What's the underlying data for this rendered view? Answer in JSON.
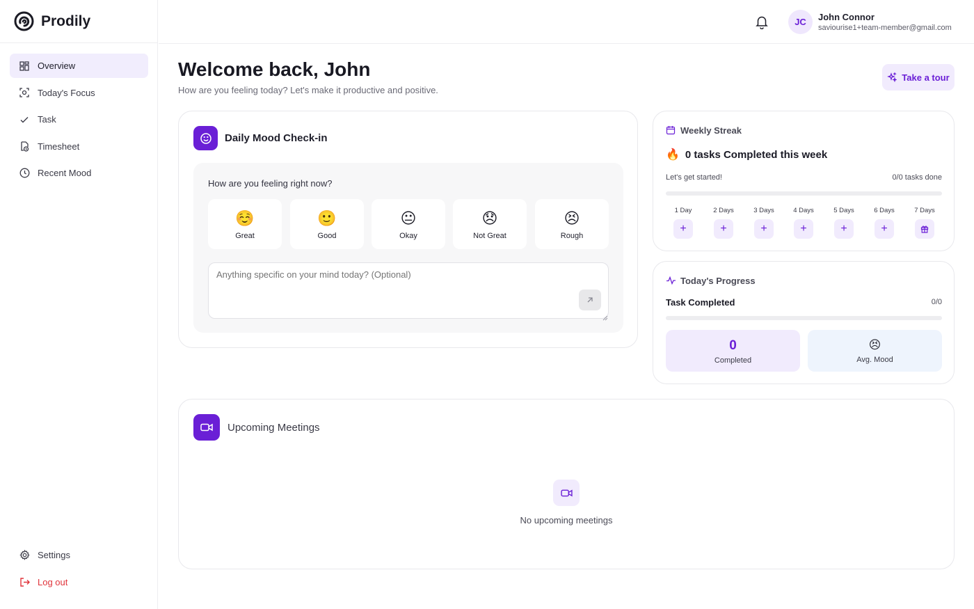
{
  "brand": {
    "name": "Prodily"
  },
  "sidebar": {
    "items": [
      {
        "label": "Overview",
        "icon": "grid-icon",
        "active": true
      },
      {
        "label": "Today's Focus",
        "icon": "focus-icon",
        "active": false
      },
      {
        "label": "Task",
        "icon": "check-icon",
        "active": false
      },
      {
        "label": "Timesheet",
        "icon": "timesheet-icon",
        "active": false
      },
      {
        "label": "Recent Mood",
        "icon": "clock-icon",
        "active": false
      }
    ],
    "bottom": [
      {
        "label": "Settings",
        "icon": "gear-icon"
      },
      {
        "label": "Log out",
        "icon": "logout-icon"
      }
    ]
  },
  "header": {
    "user": {
      "initials": "JC",
      "name": "John Connor",
      "email": "saviourise1+team-member@gmail.com"
    }
  },
  "main": {
    "welcome": "Welcome back, John",
    "subtitle": "How are you feeling today? Let's make it productive and positive.",
    "tour_label": "Take a tour"
  },
  "mood_checkin": {
    "title": "Daily Mood Check-in",
    "question": "How are you feeling right now?",
    "options": [
      {
        "emoji": "☺️",
        "label": "Great"
      },
      {
        "emoji": "🙂",
        "label": "Good"
      },
      {
        "emoji": "😐",
        "label": "Okay"
      },
      {
        "emoji": "😞",
        "label": "Not Great"
      },
      {
        "emoji": "😣",
        "label": "Rough"
      }
    ],
    "input_placeholder": "Anything specific on your mind today? (Optional)"
  },
  "weekly_streak": {
    "title": "Weekly Streak",
    "fire": "🔥",
    "headline": "0 tasks Completed this week",
    "status": "Let's get started!",
    "tasks_done": "0/0 tasks done",
    "progress": 0,
    "days": [
      {
        "label": "1 Day",
        "icon": "+"
      },
      {
        "label": "2 Days",
        "icon": "+"
      },
      {
        "label": "3 Days",
        "icon": "+"
      },
      {
        "label": "4 Days",
        "icon": "+"
      },
      {
        "label": "5 Days",
        "icon": "+"
      },
      {
        "label": "6 Days",
        "icon": "+"
      },
      {
        "label": "7 Days",
        "icon": "gift-icon"
      }
    ]
  },
  "todays_progress": {
    "title": "Today's Progress",
    "task_label": "Task Completed",
    "task_value": "0/0",
    "progress": 0,
    "completed_count": "0",
    "completed_label": "Completed",
    "avg_mood_emoji": "😣",
    "avg_mood_label": "Avg. Mood"
  },
  "meetings": {
    "title": "Upcoming Meetings",
    "empty_text": "No upcoming meetings"
  },
  "colors": {
    "accent": "#6a1fd6",
    "accent_soft": "#f1ebfd",
    "danger": "#e0333a"
  }
}
